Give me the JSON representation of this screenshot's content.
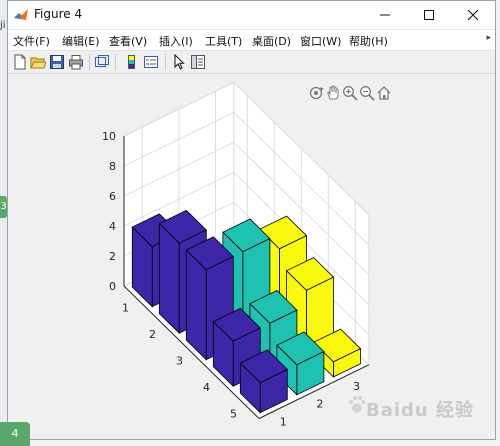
{
  "window": {
    "title": "Figure 4"
  },
  "menu": {
    "items": [
      "文件(F)",
      "编辑(E)",
      "查看(V)",
      "插入(I)",
      "工具(T)",
      "桌面(D)",
      "窗口(W)",
      "帮助(H)"
    ],
    "overflow_icon": "chevron-right-icon"
  },
  "toolbar": {
    "icons": [
      "new-figure-icon",
      "open-file-icon",
      "save-icon",
      "print-icon",
      "link-plot-icon",
      "colorbar-icon",
      "legend-icon",
      "pointer-icon",
      "property-editor-icon"
    ]
  },
  "axes_toolbar": {
    "icons": [
      "rotate-3d-icon",
      "pan-icon",
      "zoom-in-icon",
      "zoom-out-icon",
      "home-icon"
    ]
  },
  "page": {
    "left_tabs": [
      "3",
      "4"
    ],
    "left_fragment": "ji",
    "watermark": "Baidu 经验"
  },
  "chart_data": {
    "type": "bar3",
    "title": "",
    "xlabel": "",
    "ylabel": "",
    "zlabel": "",
    "row_labels": [
      "1",
      "2",
      "3",
      "4",
      "5"
    ],
    "column_labels": [
      "1",
      "2",
      "3"
    ],
    "z_ticks": [
      "0",
      "2",
      "4",
      "6",
      "8",
      "10"
    ],
    "zlim": [
      0,
      10
    ],
    "series": [
      {
        "values": [
          4,
          6,
          6,
          3,
          2
        ],
        "color": "#3e26a8"
      },
      {
        "values": [
          null,
          null,
          6,
          3,
          2
        ],
        "color": "#1fc1b0"
      },
      {
        "values": [
          null,
          null,
          5,
          4,
          1
        ],
        "color": "#f9f80f"
      }
    ],
    "grid": true,
    "colors": {
      "bar_edge": "#000000",
      "axes_bg": "#ffffff",
      "grid": "#dedede"
    }
  }
}
